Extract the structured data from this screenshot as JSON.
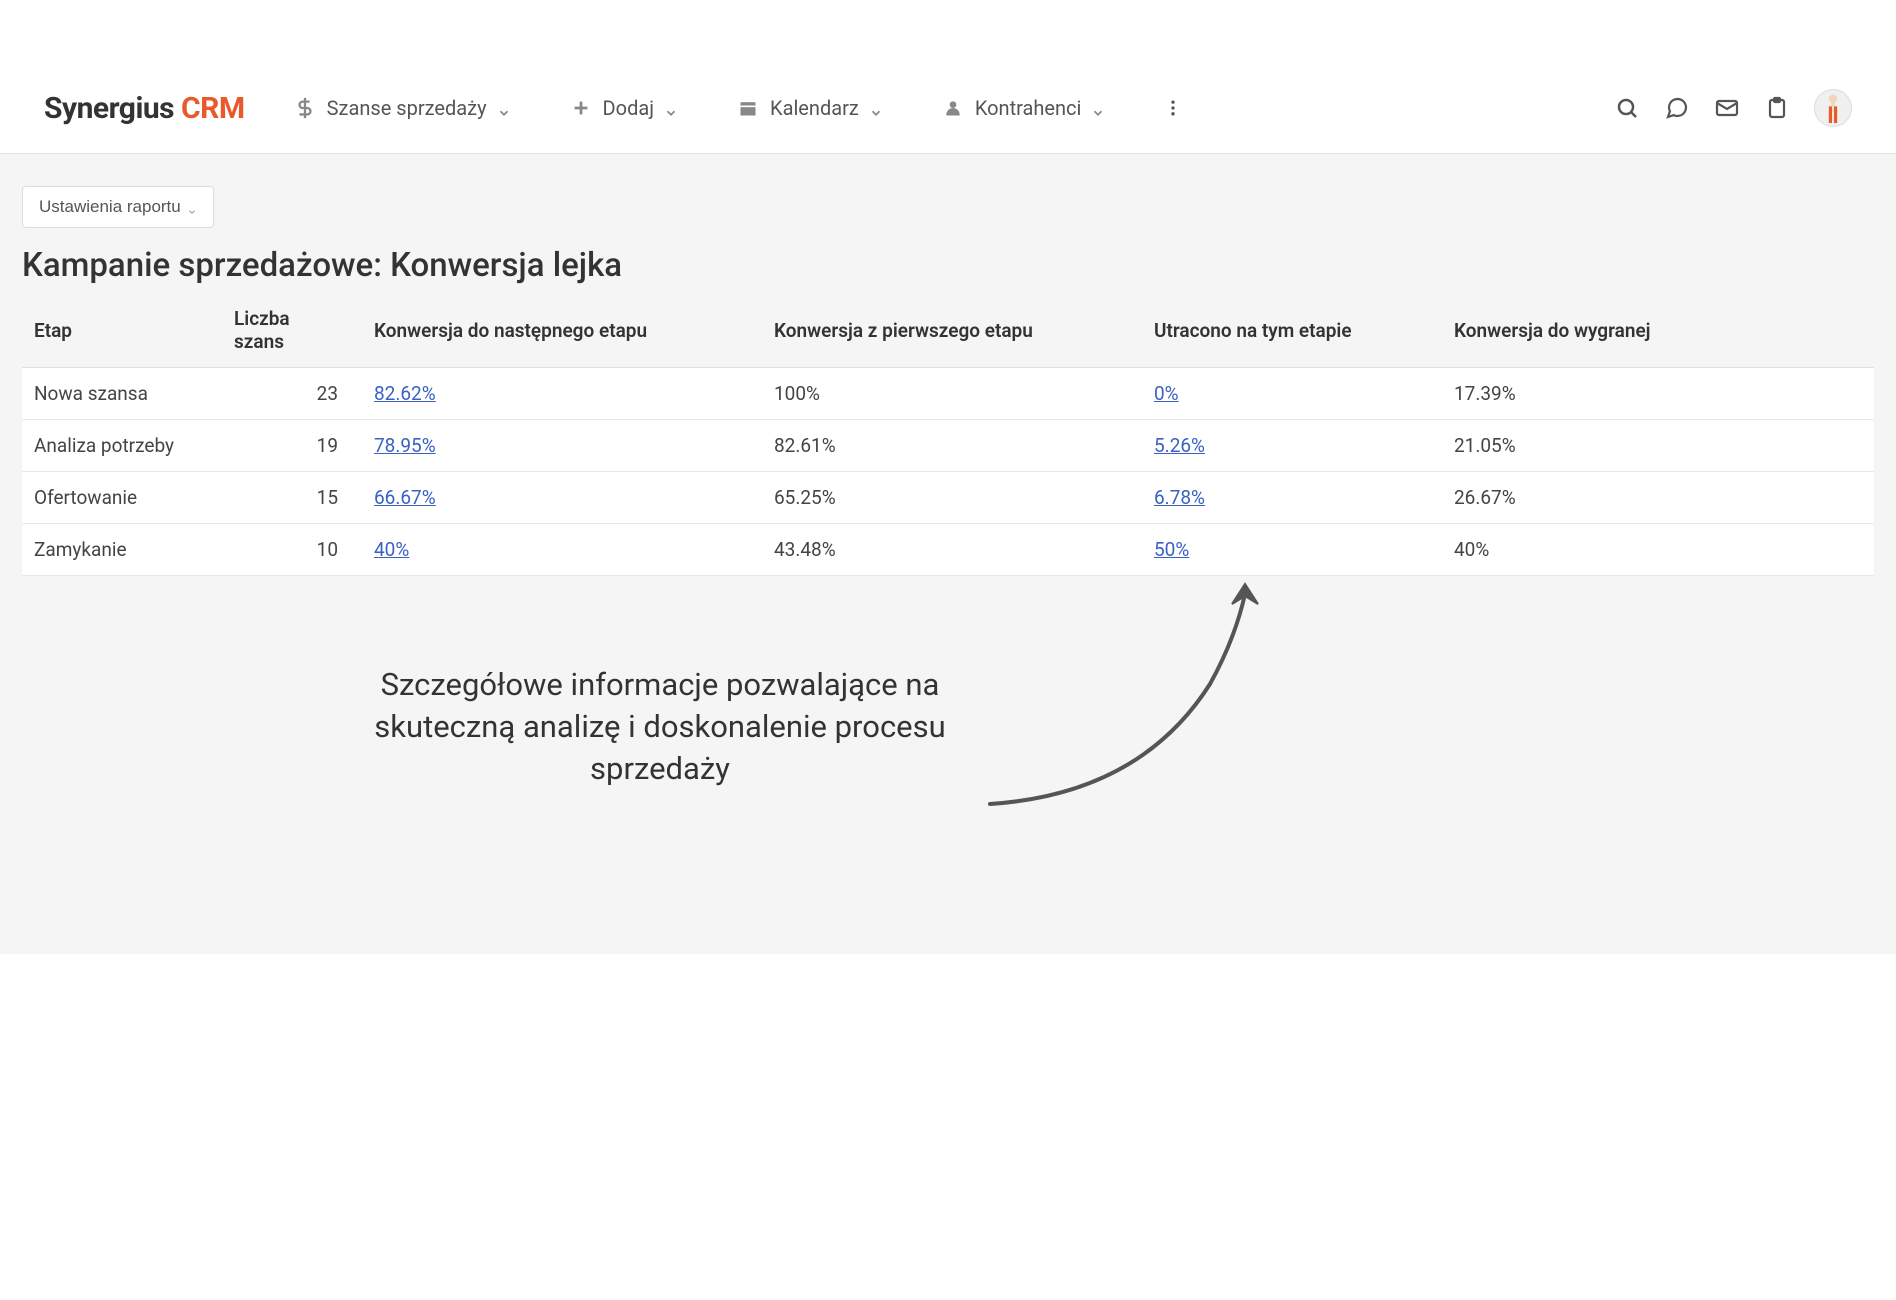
{
  "branding": {
    "logo_part1": "Synergius ",
    "logo_part2": "CRM"
  },
  "nav": {
    "items": [
      {
        "label": "Szanse sprzedaży"
      },
      {
        "label": "Dodaj"
      },
      {
        "label": "Kalendarz"
      },
      {
        "label": "Kontrahenci"
      }
    ]
  },
  "settings_button": "Ustawienia raportu",
  "page_title": "Kampanie sprzedażowe: Konwersja lejka",
  "table": {
    "headers": {
      "etap": "Etap",
      "liczba": "Liczba szans",
      "konw_next": "Konwersja do następnego etapu",
      "konw_first": "Konwersja z pierwszego etapu",
      "utracono": "Utracono na tym etapie",
      "konw_win": "Konwersja do wygranej"
    },
    "rows": [
      {
        "etap": "Nowa szansa",
        "liczba": "23",
        "konw_next": "82.62%",
        "konw_first": "100%",
        "utracono": "0%",
        "konw_win": "17.39%"
      },
      {
        "etap": "Analiza potrzeby",
        "liczba": "19",
        "konw_next": "78.95%",
        "konw_first": "82.61%",
        "utracono": "5.26%",
        "konw_win": "21.05%"
      },
      {
        "etap": "Ofertowanie",
        "liczba": "15",
        "konw_next": "66.67%",
        "konw_first": "65.25%",
        "utracono": "6.78%",
        "konw_win": "26.67%"
      },
      {
        "etap": "Zamykanie",
        "liczba": "10",
        "konw_next": "40%",
        "konw_first": "43.48%",
        "utracono": "50%",
        "konw_win": "40%"
      }
    ]
  },
  "annotation": {
    "text": "Szczegółowe informacje pozwalające na skuteczną analizę i doskonalenie procesu sprzedaży"
  }
}
